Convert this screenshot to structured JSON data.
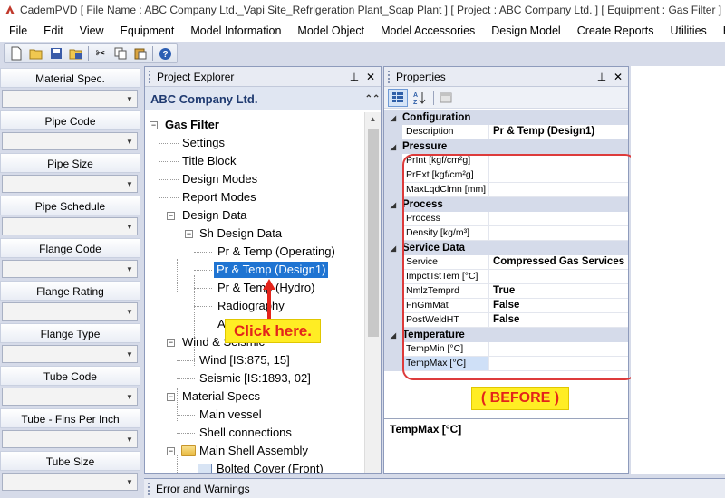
{
  "window": {
    "title": "CademPVD [ File Name : ABC Company Ltd._Vapi Site_Refrigeration Plant_Soap Plant ] [ Project : ABC Company Ltd. ] [ Equipment : Gas Filter ]"
  },
  "menu": [
    "File",
    "Edit",
    "View",
    "Equipment",
    "Model Information",
    "Model Object",
    "Model Accessories",
    "Design Model",
    "Create Reports",
    "Utilities",
    "He"
  ],
  "toolbar": {
    "icons": [
      "new-icon",
      "open-icon",
      "save-icon",
      "save-all-icon",
      "cut-icon",
      "copy-icon",
      "paste-icon",
      "help-icon"
    ]
  },
  "left_panel": {
    "fields": [
      {
        "label": "Material Spec.",
        "value": ""
      },
      {
        "label": "Pipe Code",
        "value": ""
      },
      {
        "label": "Pipe Size",
        "value": ""
      },
      {
        "label": "Pipe Schedule",
        "value": ""
      },
      {
        "label": "Flange Code",
        "value": ""
      },
      {
        "label": "Flange Rating",
        "value": ""
      },
      {
        "label": "Flange Type",
        "value": ""
      },
      {
        "label": "Tube Code",
        "value": ""
      },
      {
        "label": "Tube - Fins Per Inch",
        "value": ""
      },
      {
        "label": "Tube Size",
        "value": ""
      }
    ]
  },
  "explorer": {
    "title": "Project Explorer",
    "company": "ABC Company Ltd.",
    "tree": {
      "root": "Gas Filter",
      "settings": "Settings",
      "title_block": "Title Block",
      "design_modes": "Design Modes",
      "report_modes": "Report Modes",
      "design_data": "Design Data",
      "sh_design_data": "Sh Design Data",
      "pr_temp_operating": "Pr & Temp (Operating)",
      "pr_temp_design1": "Pr & Temp (Design1)",
      "pr_temp_hydro": "Pr & Temp (Hydro)",
      "radiography": "Radiography",
      "a_item": "A",
      "wind_seismic": "Wind & Seismic",
      "wind": "Wind [IS:875, 15]",
      "seismic": "Seismic [IS:1893, 02]",
      "material_specs": "Material Specs",
      "main_vessel": "Main vessel",
      "shell_connections": "Shell connections",
      "main_shell_assembly": "Main Shell Assembly",
      "bolted_cover": "Bolted Cover (Front)"
    },
    "callout": "Click here."
  },
  "properties": {
    "title": "Properties",
    "categories": [
      {
        "name": "Configuration",
        "rows": [
          {
            "name": "Description",
            "value": "Pr & Temp (Design1)"
          }
        ]
      },
      {
        "name": "Pressure",
        "rows": [
          {
            "name": "PrInt [kgf/cm²g]",
            "value": ""
          },
          {
            "name": "PrExt [kgf/cm²g]",
            "value": ""
          },
          {
            "name": "MaxLqdClmn [mm]",
            "value": ""
          }
        ]
      },
      {
        "name": "Process",
        "rows": [
          {
            "name": "Process",
            "value": ""
          },
          {
            "name": "Density [kg/m³]",
            "value": ""
          }
        ]
      },
      {
        "name": "Service Data",
        "rows": [
          {
            "name": "Service",
            "value": "Compressed Gas Services"
          },
          {
            "name": "ImpctTstTem [°C]",
            "value": ""
          },
          {
            "name": "NmlzTemprd",
            "value": "True"
          },
          {
            "name": "FnGmMat",
            "value": "False"
          },
          {
            "name": "PostWeldHT",
            "value": "False"
          }
        ]
      },
      {
        "name": "Temperature",
        "rows": [
          {
            "name": "TempMin [°C]",
            "value": ""
          },
          {
            "name": "TempMax [°C]",
            "value": ""
          }
        ]
      }
    ],
    "before_label": "( BEFORE )",
    "description_title": "TempMax [°C]"
  },
  "error_panel": {
    "title": "Error and Warnings"
  }
}
